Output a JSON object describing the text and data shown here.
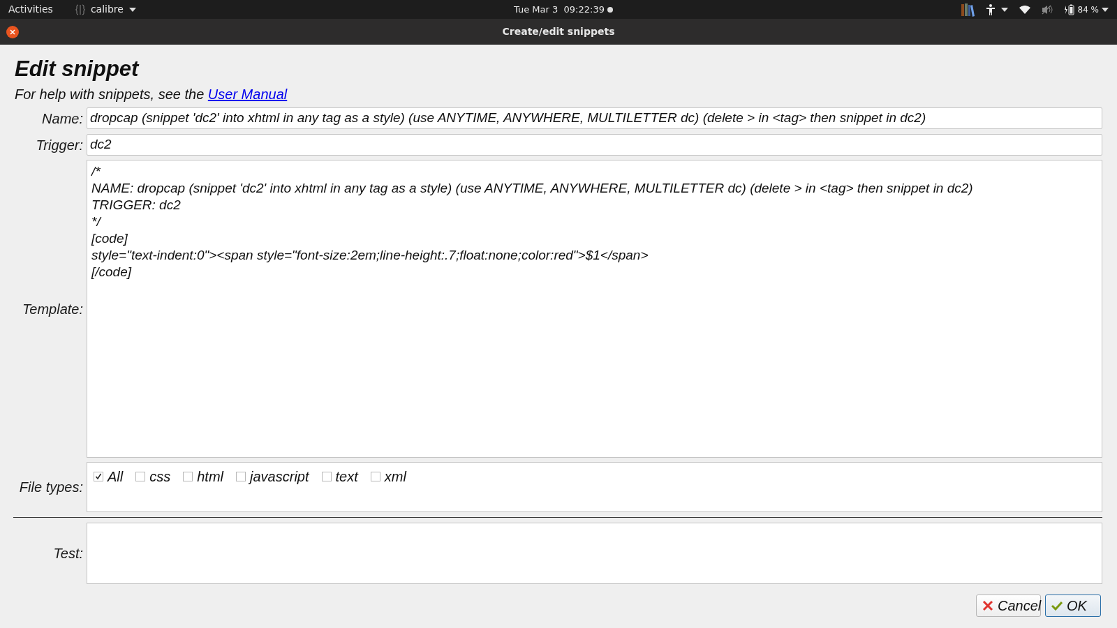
{
  "top_bar": {
    "activities": "Activities",
    "app_menu": "calibre",
    "clock": "Tue Mar 3  09:22:39",
    "battery": "84 %"
  },
  "window": {
    "title": "Create/edit snippets"
  },
  "heading": "Edit snippet",
  "help": {
    "text": "For help with snippets, see the",
    "link": "User Manual"
  },
  "name": {
    "label": "Name:",
    "value": "dropcap (snippet 'dc2' into xhtml in any tag as a style) (use ANYTIME, ANYWHERE, MULTILETTER dc) (delete > in <tag> then snippet in dc2)"
  },
  "trigger": {
    "label": "Trigger:",
    "value": "dc2"
  },
  "template": {
    "label": "Template:",
    "lines": [
      "/*",
      "NAME: dropcap (snippet 'dc2' into xhtml in any tag as a style) (use ANYTIME, ANYWHERE, MULTILETTER dc) (delete > in <tag> then snippet in dc2)",
      "TRIGGER: dc2",
      "*/",
      "[code]",
      "style=\"text-indent:0\"><span style=\"font-size:2em;line-height:.7;float:none;color:red\">$1</span>",
      "[/code]"
    ]
  },
  "file_types": {
    "label": "File types:",
    "options": [
      {
        "label": "All",
        "checked": true
      },
      {
        "label": "css",
        "checked": false
      },
      {
        "label": "html",
        "checked": false
      },
      {
        "label": "javascript",
        "checked": false
      },
      {
        "label": "text",
        "checked": false
      },
      {
        "label": "xml",
        "checked": false
      }
    ]
  },
  "test": {
    "label": "Test:"
  },
  "buttons": [
    {
      "kind": "cancel",
      "label": "Cancel"
    },
    {
      "kind": "ok",
      "label": "OK"
    }
  ]
}
